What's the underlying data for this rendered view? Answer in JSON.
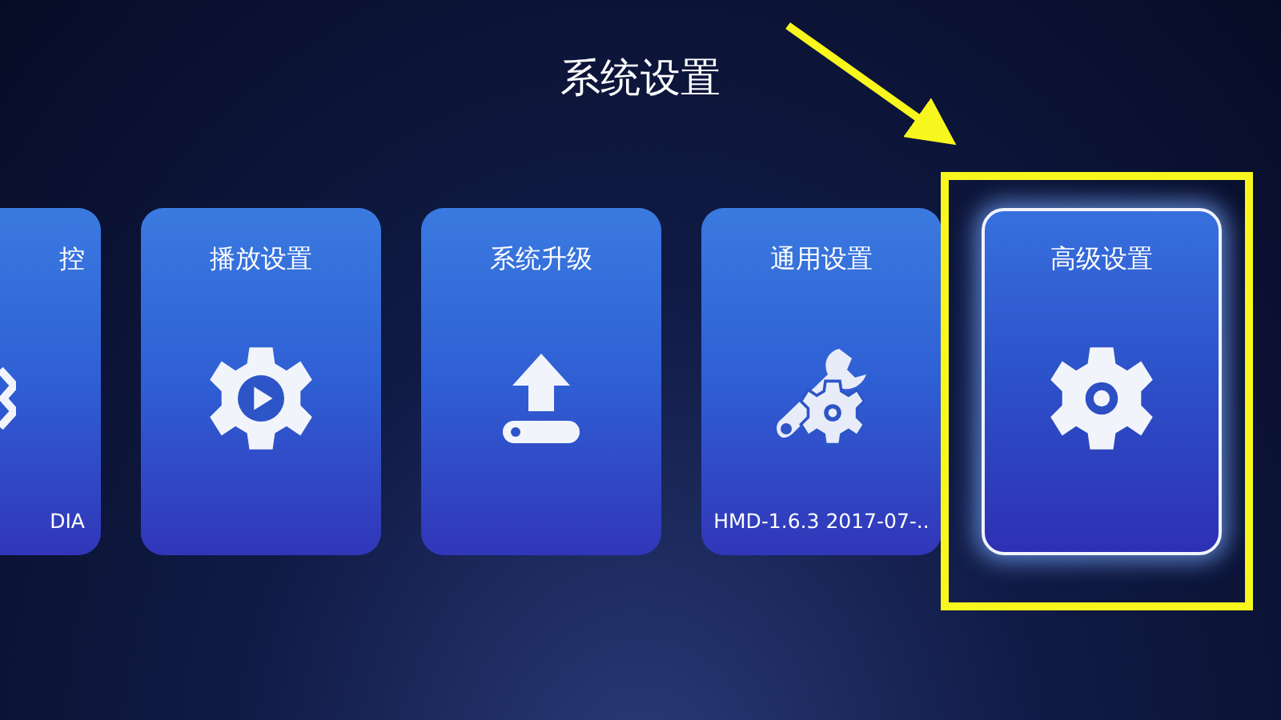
{
  "title": "系统设置",
  "cards": [
    {
      "kind": "partial",
      "label": "控",
      "footer": "DIA",
      "selected": false
    },
    {
      "kind": "full",
      "label": "播放设置",
      "selected": false
    },
    {
      "kind": "full",
      "label": "系统升级",
      "selected": false
    },
    {
      "kind": "full",
      "label": "通用设置",
      "footer": "HMD-1.6.3 2017-07-..",
      "selected": false
    },
    {
      "kind": "full",
      "label": "高级设置",
      "selected": true
    }
  ],
  "annotation": {
    "kind": "arrow-and-box"
  }
}
